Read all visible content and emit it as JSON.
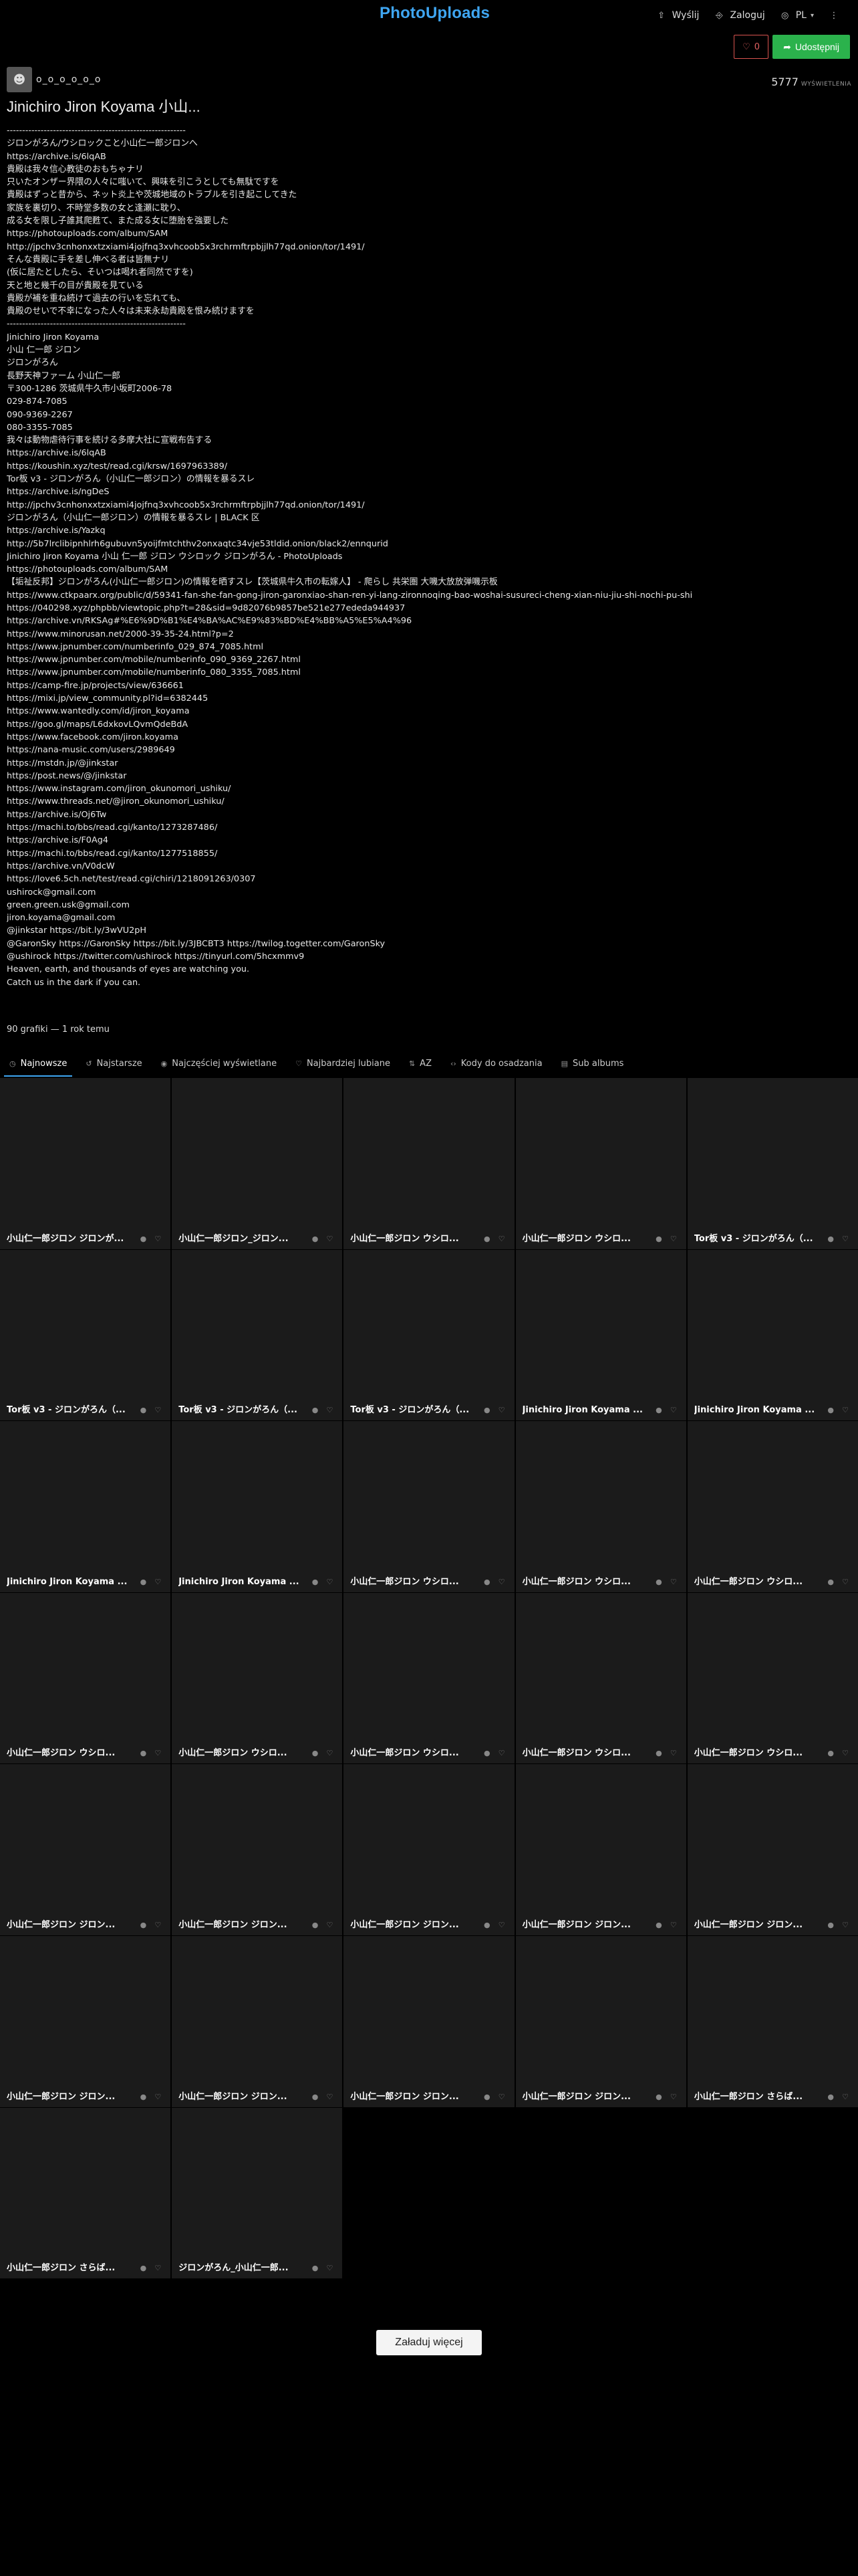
{
  "header": {
    "logo": "PhotoUploads",
    "nav": [
      {
        "label": "Wyślij",
        "icon": "upload-icon"
      },
      {
        "label": "Zaloguj",
        "icon": "login-icon"
      },
      {
        "label": "PL",
        "icon": "globe-icon"
      }
    ],
    "menu_icon": "more-icon"
  },
  "actions": {
    "like_count": "0",
    "share_label": "Udostępnij"
  },
  "owner": {
    "username": "o_o_o_o_o_o"
  },
  "views": {
    "count": "5777",
    "label": "WYŚWIETLENIA"
  },
  "album": {
    "title": "Jinichiro Jiron Koyama 小山..."
  },
  "description": [
    "----------------------------------------------------------",
    "ジロンがろん/ウシロックこと小山仁一郎ジロンへ",
    "https://archive.is/6lqAB",
    "貴殿は我々信心教徒のおもちゃナリ",
    "只いたオンザー界隈の人々に嗤いて、興味を引こうとしても無駄ですを",
    "貴殿はずっと昔から、ネット炎上や茨城地域のトラブルを引き起こしてきた",
    "家族を裏切り、不時堂多数の女と逢瀬に耽り、",
    "成る女を限し子誰其爬甦て、また成る女に堕胎を強要した",
    "https://photouploads.com/album/SAM",
    "http://jpchv3cnhonxxtzxiami4jojfnq3xvhcoob5x3rchrmftrpbjjlh77qd.onion/tor/1491/",
    "そんな貴殿に手を差し伸べる者は皆無ナリ",
    "(仮に居たとしたら、そいつは喝れ者同然ですを)",
    "天と地と幾千の目が貴殿を見ている",
    "貴殿が補を重ね続けて過去の行いを忘れても、",
    "貴殿のせいで不幸になった人々は未来永劫貴殿を恨み続けますを",
    "----------------------------------------------------------",
    "Jinichiro Jiron Koyama",
    "小山 仁一郎 ジロン",
    "ジロンがろん",
    "長野天神ファーム 小山仁一郎",
    "〒300-1286 茨城県牛久市小坂町2006-78",
    "029-874-7085",
    "090-9369-2267",
    "080-3355-7085",
    "我々は動物虐待行事を続ける多摩大社に宣戦布告する",
    "https://archive.is/6lqAB",
    "https://koushin.xyz/test/read.cgi/krsw/1697963389/",
    "Tor板 v3 - ジロンがろん（小山仁一郎ジロン）の情報を暴るスレ",
    "https://archive.is/ngDeS",
    "http://jpchv3cnhonxxtzxiami4jojfnq3xvhcoob5x3rchrmftrpbjjlh77qd.onion/tor/1491/",
    "ジロンがろん（小山仁一郎ジロン）の情報を暴るスレ | BLACK 区",
    "https://archive.is/Yazkq",
    "http://5b7lrclibipnhlrh6gubuvn5yoijfmtchthv2onxaqtc34vje53tldid.onion/black2/ennqurid",
    "Jinichiro Jiron Koyama 小山 仁一郎 ジロン ウシロック ジロンがろん - PhotoUploads",
    "https://photouploads.com/album/SAM",
    "【垢祉反邦】ジロンがろん(小山仁一郎ジロン)の情報を晒すスレ【茨城県牛久市の転嫁人】 - 爬らし 共栄圏 大嘰大放放弹嘰示板",
    "https://www.ctkpaarx.org/public/d/59341-fan-she-fan-gong-jiron-garonxiao-shan-ren-yi-lang-zironnoqing-bao-woshai-susureci-cheng-xian-niu-jiu-shi-nochi-pu-shi",
    "https://040298.xyz/phpbb/viewtopic.php?t=28&sid=9d82076b9857be521e277ededa944937",
    "https://archive.vn/RKSAg#%E6%9D%B1%E4%BA%AC%E9%83%BD%E4%BB%A5%E5%A4%96",
    "https://www.minorusan.net/2000-39-35-24.html?p=2",
    "https://www.jpnumber.com/numberinfo_029_874_7085.html",
    "https://www.jpnumber.com/mobile/numberinfo_090_9369_2267.html",
    "https://www.jpnumber.com/mobile/numberinfo_080_3355_7085.html",
    "https://camp-fire.jp/projects/view/636661",
    "https://mixi.jp/view_community.pl?id=6382445",
    "https://www.wantedly.com/id/jiron_koyama",
    "https://goo.gl/maps/L6dxkovLQvmQdeBdA",
    "https://www.facebook.com/jiron.koyama",
    "https://nana-music.com/users/2989649",
    "https://mstdn.jp/@jinkstar",
    "https://post.news/@/jinkstar",
    "https://www.instagram.com/jiron_okunomori_ushiku/",
    "https://www.threads.net/@jiron_okunomori_ushiku/",
    "https://archive.is/Oj6Tw",
    "https://machi.to/bbs/read.cgi/kanto/1273287486/",
    "https://archive.is/F0Ag4",
    "https://machi.to/bbs/read.cgi/kanto/1277518855/",
    "https://archive.vn/V0dcW",
    "https://love6.5ch.net/test/read.cgi/chiri/1218091263/0307",
    "ushirock@gmail.com",
    "green.green.usk@gmail.com",
    "jiron.koyama@gmail.com",
    "@jinkstar https://bit.ly/3wVU2pH",
    "@GaronSky https://GaronSky https://bit.ly/3JBCBT3 https://twilog.togetter.com/GaronSky",
    "@ushirock https://twitter.com/ushirock https://tinyurl.com/5hcxmmv9",
    "Heaven, earth, and thousands of eyes are watching you.",
    "Catch us in the dark if you can."
  ],
  "stats": {
    "count_text": "90 grafiki — 1 rok temu"
  },
  "tabs": [
    {
      "label": "Najnowsze",
      "icon": "clock-icon",
      "active": true
    },
    {
      "label": "Najstarsze",
      "icon": "history-icon",
      "active": false
    },
    {
      "label": "Najczęściej wyświetlane",
      "icon": "eye-icon",
      "active": false
    },
    {
      "label": "Najbardziej lubiane",
      "icon": "heart-icon",
      "active": false
    },
    {
      "label": "AZ",
      "icon": "sort-alpha-icon",
      "active": false
    },
    {
      "label": "Kody do osadzania",
      "icon": "code-icon",
      "active": false
    },
    {
      "label": "Sub albums",
      "icon": "albums-icon",
      "active": false
    }
  ],
  "images": [
    "小山仁一郎ジロン ジロンが...",
    "小山仁一郎ジロン_ジロン...",
    "小山仁一郎ジロン ウシロ...",
    "小山仁一郎ジロン ウシロ...",
    "Tor板 v3 - ジロンがろん（...",
    "Tor板 v3 - ジロンがろん（...",
    "Tor板 v3 - ジロンがろん（...",
    "Tor板 v3 - ジロンがろん（...",
    "Jinichiro Jiron Koyama ...",
    "Jinichiro Jiron Koyama ...",
    "Jinichiro Jiron Koyama ...",
    "Jinichiro Jiron Koyama ...",
    "小山仁一郎ジロン ウシロ...",
    "小山仁一郎ジロン ウシロ...",
    "小山仁一郎ジロン ウシロ...",
    "小山仁一郎ジロン ウシロ...",
    "小山仁一郎ジロン ウシロ...",
    "小山仁一郎ジロン ウシロ...",
    "小山仁一郎ジロン ウシロ...",
    "小山仁一郎ジロン ウシロ...",
    "小山仁一郎ジロン ジロン...",
    "小山仁一郎ジロン ジロン...",
    "小山仁一郎ジロン ジロン...",
    "小山仁一郎ジロン ジロン...",
    "小山仁一郎ジロン ジロン...",
    "小山仁一郎ジロン ジロン...",
    "小山仁一郎ジロン ジロン...",
    "小山仁一郎ジロン ジロン...",
    "小山仁一郎ジロン ジロン...",
    "小山仁一郎ジロン さらば...",
    "小山仁一郎ジロン さらば...",
    "ジロンがろん_小山仁一郎..."
  ],
  "load_more": "Załaduj więcej"
}
